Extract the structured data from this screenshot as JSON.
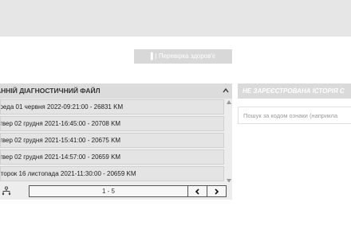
{
  "toolbar": {
    "health_check_label": "▌| Перевірка здоров'є"
  },
  "diag_panel": {
    "title": "АННІЙ ДІАГНОСТИЧНИЙ ФАЙЛ",
    "files": [
      "ереда 01 червня 2022-09:21:00 - 26831 KM",
      "етвер 02 грудня 2021-16:45:00 - 20708 KM",
      "етвер 02 грудня 2021-15:41:00 - 20675 KM",
      "етвер 02 грудня 2021-14:57:00 - 20659 KM",
      "івторок 16 листопада 2021-11:30:00 - 20659 KM"
    ],
    "pager": {
      "info": "1 - 5"
    }
  },
  "history_panel": {
    "title": "НЕ ЗАРЕЄСТРОВАНА ІСТОРІЯ С",
    "search_placeholder": "Пошук за кодом ознаки (наприкла"
  },
  "colors": {
    "topbar": "#e6e6e6",
    "panel_bg": "#ededed",
    "row_bg": "#e4e4e4",
    "header_bg": "#dcdcdc"
  }
}
